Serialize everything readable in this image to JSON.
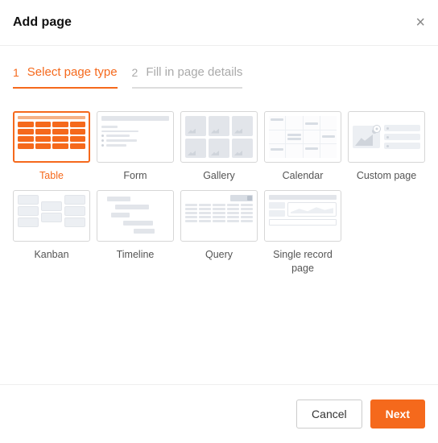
{
  "dialog": {
    "title": "Add page"
  },
  "steps": [
    {
      "num": "1",
      "label": "Select page type",
      "active": true
    },
    {
      "num": "2",
      "label": "Fill in page details",
      "active": false
    }
  ],
  "options": [
    {
      "key": "table",
      "label": "Table",
      "selected": true
    },
    {
      "key": "form",
      "label": "Form",
      "selected": false
    },
    {
      "key": "gallery",
      "label": "Gallery",
      "selected": false
    },
    {
      "key": "calendar",
      "label": "Calendar",
      "selected": false
    },
    {
      "key": "custom",
      "label": "Custom page",
      "selected": false
    },
    {
      "key": "kanban",
      "label": "Kanban",
      "selected": false
    },
    {
      "key": "timeline",
      "label": "Timeline",
      "selected": false
    },
    {
      "key": "query",
      "label": "Query",
      "selected": false
    },
    {
      "key": "single_record",
      "label": "Single record page",
      "selected": false
    }
  ],
  "footer": {
    "cancel": "Cancel",
    "next": "Next"
  }
}
